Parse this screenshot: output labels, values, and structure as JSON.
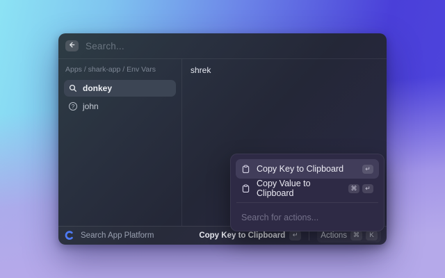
{
  "header": {
    "search_placeholder": "Search..."
  },
  "sidebar": {
    "breadcrumb": "Apps / shark-app / Env Vars",
    "items": [
      {
        "label": "donkey",
        "icon": "magnifier-icon",
        "selected": true
      },
      {
        "label": "john",
        "icon": "question-icon",
        "selected": false,
        "icon_glyph": "?"
      }
    ]
  },
  "detail": {
    "value": "shrek"
  },
  "actions_popover": {
    "items": [
      {
        "label": "Copy Key to Clipboard",
        "keys": [
          "↵"
        ],
        "selected": true
      },
      {
        "label": "Copy Value to Clipboard",
        "keys": [
          "⌘",
          "↵"
        ],
        "selected": false
      }
    ],
    "search_placeholder": "Search for actions..."
  },
  "footer": {
    "app_name": "Search App Platform",
    "primary_action_label": "Copy Key to Clipboard",
    "primary_action_key": "↵",
    "actions_label": "Actions",
    "actions_keys": [
      "⌘",
      "K"
    ]
  },
  "colors": {
    "accent_logo_blue": "#4e7bf7",
    "selection_row_gray": "#3c4554",
    "selection_action_purple": "#413d5a",
    "popover_background": "#2e2a45",
    "background_cyan": "#8ce3f4",
    "background_indigo": "#4a3fd9",
    "background_violet": "#b5a9ea"
  }
}
